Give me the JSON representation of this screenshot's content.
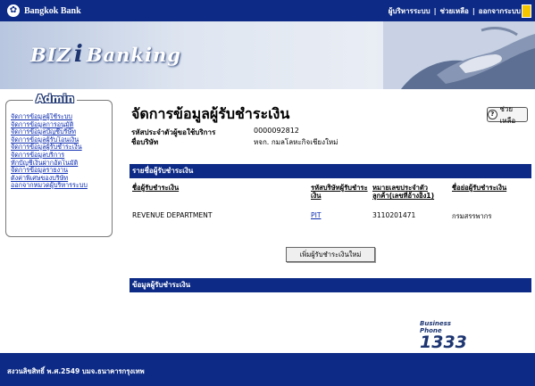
{
  "header": {
    "bank_name": "Bangkok Bank",
    "links": [
      "ผู้บริหารระบบ",
      "ช่วยเหลือ",
      "ออกจากระบบ"
    ]
  },
  "banner": {
    "brand_left": "BIZ",
    "brand_i": "i",
    "brand_right": "Banking"
  },
  "sidebar": {
    "title": "Admin",
    "items": [
      "จัดการข้อมูลผู้ใช้ระบบ",
      "จัดการข้อมูลการอนุมัติ",
      "จัดการข้อมูลบัญชีบริษัท",
      "จัดการข้อมูลผู้รับโอนเงิน",
      "จัดการข้อมูลผู้รับชำระเงิน",
      "จัดการข้อมูลบริการ",
      "หักบัญชีเงินฝากอัตโนมัติ",
      "จัดการข้อมูลรายงาน",
      "ตั้งค่าพิเศษของบริษัท",
      "ออกจากหมวดผู้บริหารระบบ"
    ]
  },
  "main": {
    "title": "จัดการข้อมูลผู้รับชำระเงิน",
    "help_label": "ช่วยเหลือ",
    "customer_id_label": "รหัสประจำตัวผู้ขอใช้บริการ",
    "customer_id_value": "0000092812",
    "company_label": "ชื่อบริษัท",
    "company_value": "หจก. กมลโลหะกิจเชียงใหม่",
    "list_bar": "รายชื่อผู้รับชำระเงิน",
    "columns": {
      "name": "ชื่อผู้รับชำระเงิน",
      "code": "รหัสบริษัทผู้รับชำระเงิน",
      "ref": "หมายเลขประจำตัวลูกค้า(เลขที่อ้างอิง1)",
      "short": "ชื่อย่อผู้รับชำระเงิน"
    },
    "row": {
      "name": "REVENUE DEPARTMENT",
      "code": "PIT",
      "ref": "3110201471",
      "short": "กรมสรรพากร"
    },
    "add_button": "เพิ่มผู้รับชำระเงินใหม่",
    "info_bar": "ข้อมูลผู้รับชำระเงิน",
    "phone_brand": "Business Phone",
    "phone_number": "1333"
  },
  "footer": {
    "copyright": "สงวนลิขสิทธิ์ พ.ศ.2549 บมจ.ธนาคารกรุงเทพ"
  },
  "colors": {
    "primary": "#0d2b86",
    "link": "#0b2bb0",
    "accent": "#f3c400"
  }
}
